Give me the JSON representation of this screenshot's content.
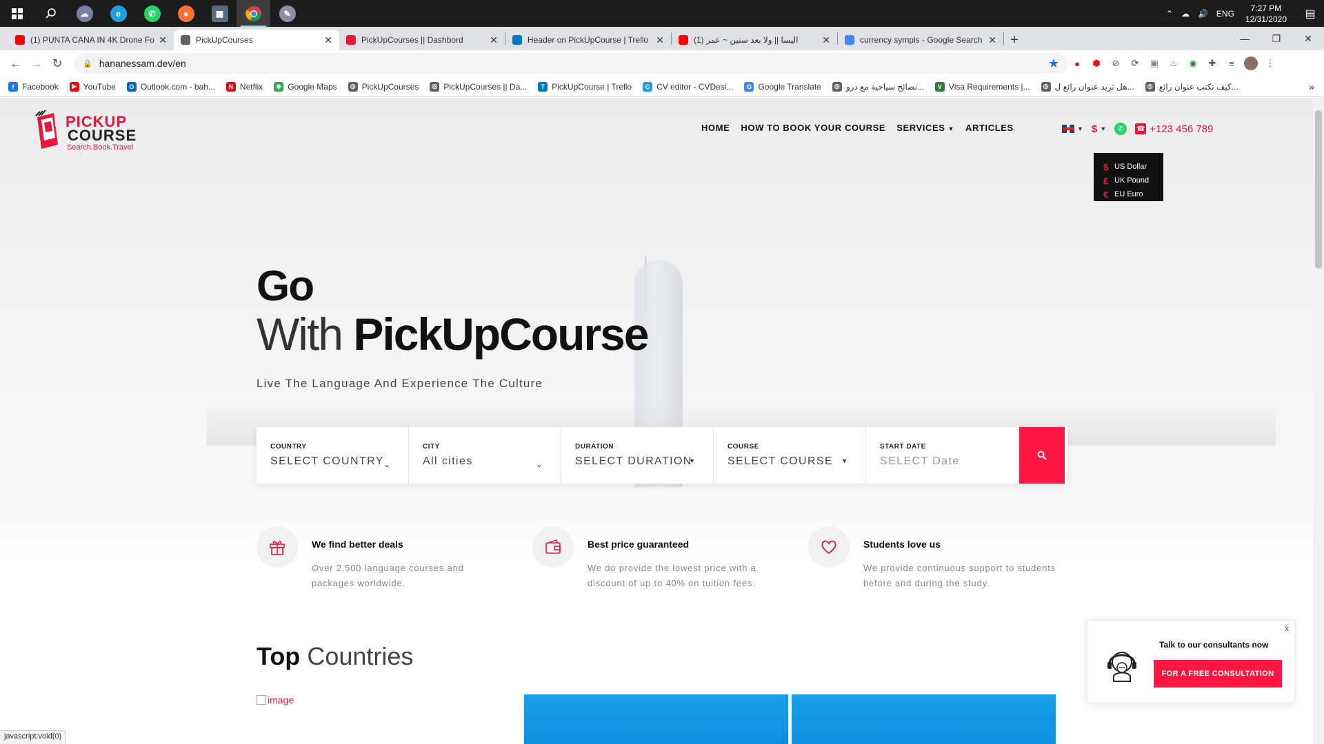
{
  "taskbar": {
    "apps": [
      "windows-start",
      "search",
      "weather-app",
      "edge",
      "whatsapp",
      "firefox",
      "calculator",
      "chrome",
      "paint"
    ],
    "tray": {
      "language": "ENG",
      "time": "7:27 PM",
      "date": "12/31/2020"
    }
  },
  "browser": {
    "tabs": [
      {
        "title": "(1) PUNTA CANA IN 4K Drone Fo",
        "icon": "youtube-icon",
        "color": "#ff0000"
      },
      {
        "title": "PickUpCourses",
        "icon": "globe-icon",
        "color": "#5f6368",
        "active": true
      },
      {
        "title": "PickUpCourses || Dashbord",
        "icon": "pickup-icon",
        "color": "#e8173c"
      },
      {
        "title": "Header on PickUpCourse | Trello",
        "icon": "trello-icon",
        "color": "#0079bf"
      },
      {
        "title": "(1) اليسا || ولا بعد ستين ~ عمر",
        "icon": "youtube-icon",
        "color": "#ff0000"
      },
      {
        "title": "currency sympls - Google Search",
        "icon": "google-icon",
        "color": "#4285f4"
      }
    ],
    "url": "hananessam.dev/en",
    "bookmarks": [
      {
        "label": "Facebook",
        "color": "#1877f2",
        "glyph": "f"
      },
      {
        "label": "YouTube",
        "color": "#ff0000",
        "glyph": "▶"
      },
      {
        "label": "Outlook.com - bah...",
        "color": "#0a64c8",
        "glyph": "O"
      },
      {
        "label": "Netflix",
        "color": "#e50914",
        "glyph": "N"
      },
      {
        "label": "Google Maps",
        "color": "#34a853",
        "glyph": "◆"
      },
      {
        "label": "PickUpCourses",
        "color": "#5f6368",
        "glyph": "◎"
      },
      {
        "label": "PickUpCourses || Da...",
        "color": "#5f6368",
        "glyph": "◎"
      },
      {
        "label": "PickUpCourse | Trello",
        "color": "#0079bf",
        "glyph": "T"
      },
      {
        "label": "CV editor - CVDesi...",
        "color": "#1aa0e8",
        "glyph": "C"
      },
      {
        "label": "Google Translate",
        "color": "#4285f4",
        "glyph": "G"
      },
      {
        "label": "نصائح سياحية مع درو...",
        "color": "#5f6368",
        "glyph": "◎"
      },
      {
        "label": "Visa Requirements |...",
        "color": "#2e7d32",
        "glyph": "V"
      },
      {
        "label": "هل تريد عنوان رائع ل...",
        "color": "#5f6368",
        "glyph": "◎"
      },
      {
        "label": "كيف تكتب عنوان رائع...",
        "color": "#5f6368",
        "glyph": "◎"
      }
    ],
    "status_url": "javascript:void(0)"
  },
  "site": {
    "logo": {
      "line1": "PICKUP",
      "line2": "COURSE",
      "tagline": "Search.Book.Travel"
    },
    "nav": [
      {
        "label": "HOME"
      },
      {
        "label": "HOW TO BOOK YOUR COURSE"
      },
      {
        "label": "SERVICES"
      },
      {
        "label": "ARTICLES"
      }
    ],
    "currency_symbol": "$",
    "phone": "+123 456 789",
    "currency_menu": [
      {
        "symbol": "$",
        "label": "US Dollar"
      },
      {
        "symbol": "£",
        "label": "UK Pound"
      },
      {
        "symbol": "€",
        "label": "EU Euro"
      }
    ],
    "hero": {
      "line1": "Go",
      "line2_light": "With ",
      "line2_bold": "PickUpCourse",
      "subtitle": "Live The Language And Experience The Culture"
    },
    "search": {
      "fields": [
        {
          "label": "COUNTRY",
          "value": "SELECT COUNTRY"
        },
        {
          "label": "CITY",
          "value": "All cities"
        },
        {
          "label": "DURATION",
          "value": "SELECT DURATION"
        },
        {
          "label": "COURSE",
          "value": "SELECT COURSE"
        }
      ],
      "date": {
        "label": "START DATE",
        "placeholder": "SELECT Date"
      }
    },
    "features": [
      {
        "title": "We find better deals",
        "text": "Over 2,500 language courses and packages worldwide."
      },
      {
        "title": "Best price guaranteed",
        "text": "We do provide the lowest price with a discount of up to 40% on tuition fees."
      },
      {
        "title": "Students love us",
        "text": "We provide continuous support to students before and during the study."
      }
    ],
    "top_countries": {
      "bold": "Top",
      "light": " Countries",
      "img_alt": "image"
    },
    "consult": {
      "close": "x",
      "title": "Talk to our consultants now",
      "button": "FOR A FREE CONSULTATION"
    },
    "accent": "#ff1744"
  }
}
